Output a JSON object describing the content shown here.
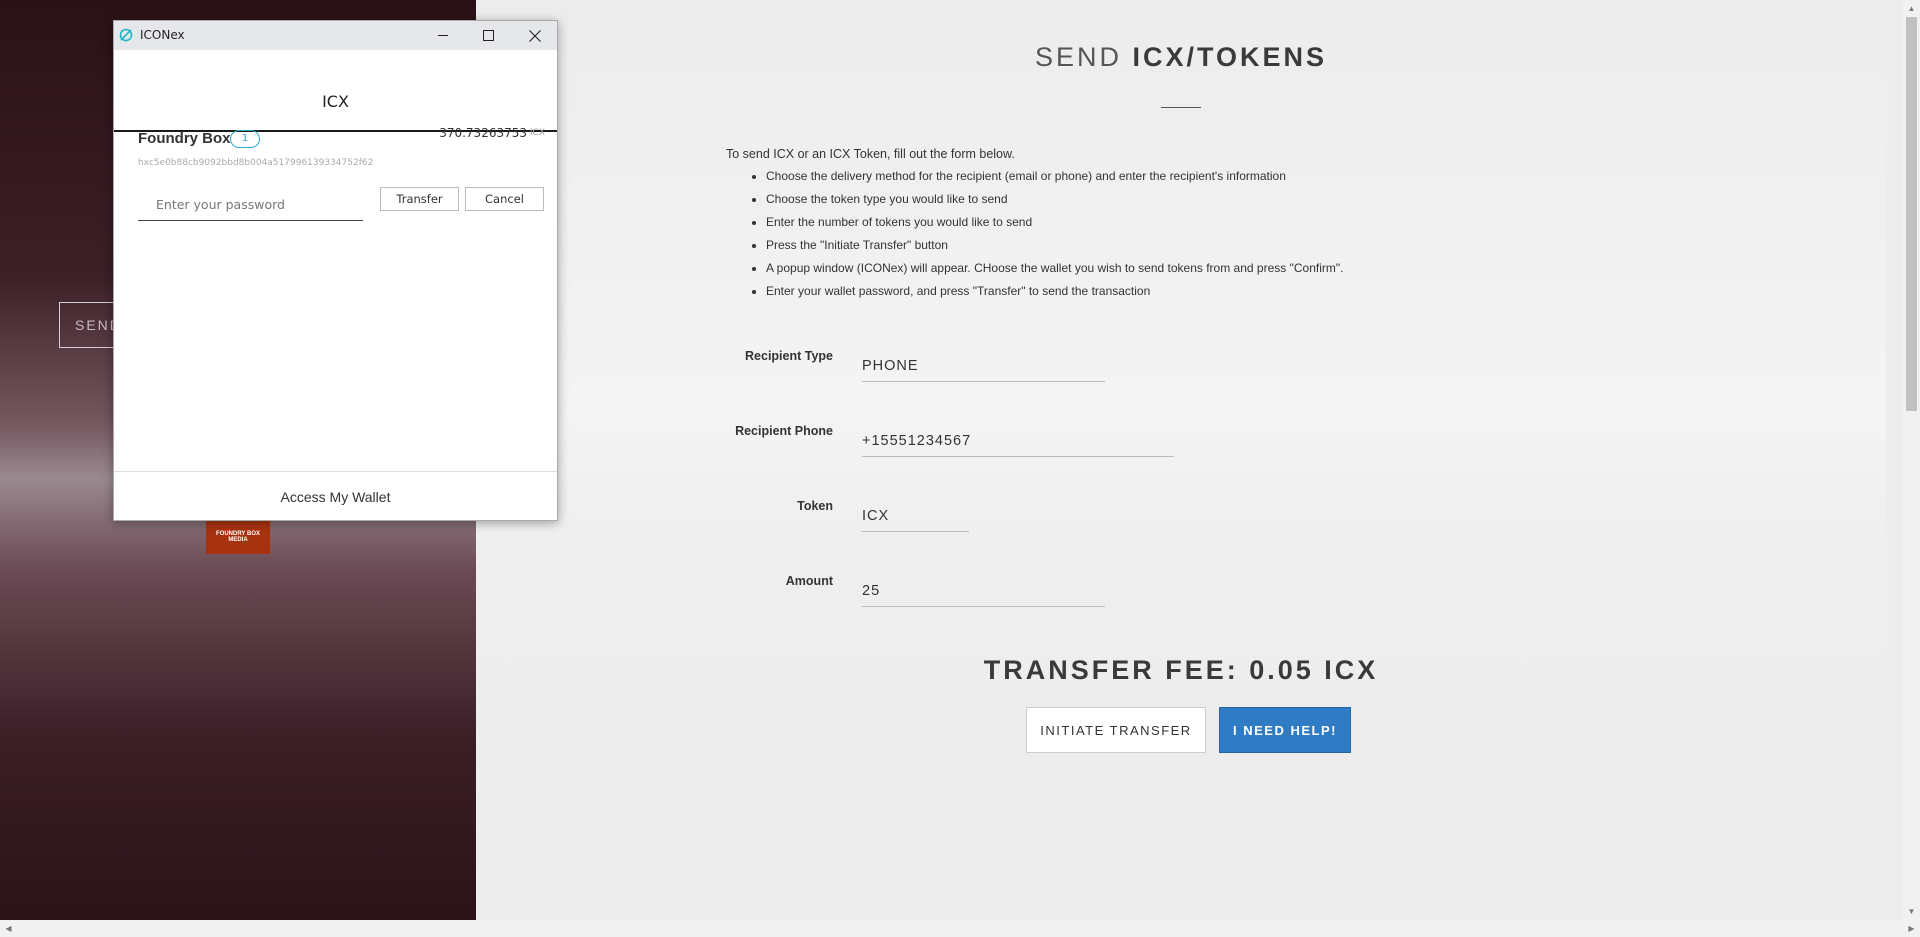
{
  "sidebar": {
    "send_button_label": "SEND",
    "logo_text": "FOUNDRY BOX MEDIA"
  },
  "main": {
    "title_light": "SEND ",
    "title_bold": "ICX/TOKENS",
    "intro": "To send ICX or an ICX Token, fill out the form below.",
    "steps": [
      "Choose the delivery method for the recipient (email or phone) and enter the recipient's information",
      "Choose the token type you would like to send",
      "Enter the number of tokens you would like to send",
      "Press the \"Initiate Transfer\" button",
      "A popup window (ICONex) will appear. CHoose the wallet you wish to send tokens from and press \"Confirm\".",
      "Enter your wallet password, and press \"Transfer\" to send the transaction"
    ],
    "form": {
      "recipient_type_label": "Recipient Type",
      "recipient_type_value": "PHONE",
      "recipient_phone_label": "Recipient Phone",
      "recipient_phone_value": "+15551234567",
      "token_label": "Token",
      "token_value": "ICX",
      "amount_label": "Amount",
      "amount_value": "25"
    },
    "transfer_fee": "TRANSFER FEE: 0.05 ICX",
    "initiate_button": "INITIATE TRANSFER",
    "help_button": "I NEED HELP!"
  },
  "popup": {
    "window_title": "ICONex",
    "header_title": "ICX",
    "wallet_name": "Foundry Box",
    "wallet_badge": "1",
    "balance": "370.73263753",
    "balance_unit": "ICX",
    "address": "hxc5e0b88cb9092bbd8b004a517996139334752f62",
    "password_placeholder": "Enter your password",
    "transfer_button": "Transfer",
    "cancel_button": "Cancel",
    "footer_link": "Access My Wallet"
  },
  "colors": {
    "accent_blue": "#2f7bc4",
    "badge_cyan": "#27aad1",
    "sidebar_dark": "#2a1117"
  }
}
